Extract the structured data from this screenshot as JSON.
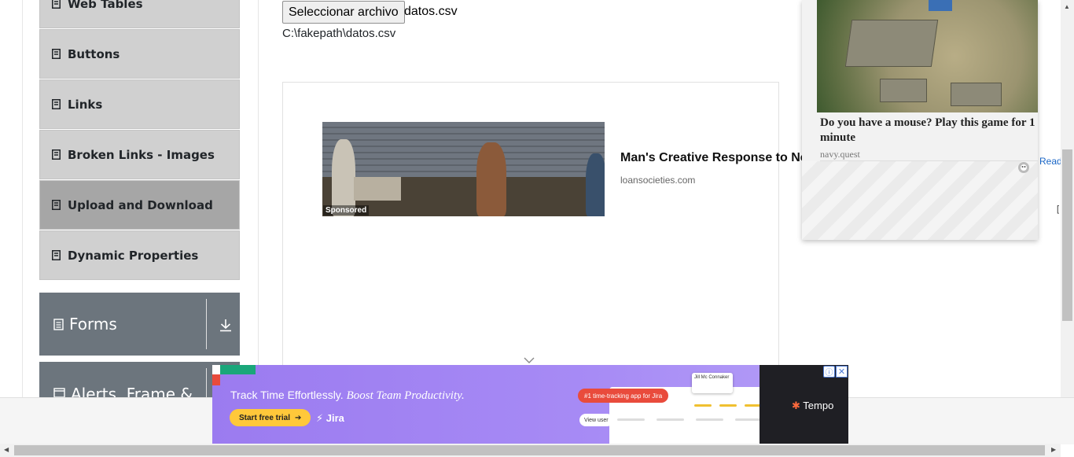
{
  "sidebar": {
    "items": [
      {
        "label": "Web Tables",
        "active": false
      },
      {
        "label": "Buttons",
        "active": false
      },
      {
        "label": "Links",
        "active": false
      },
      {
        "label": "Broken Links - Images",
        "active": false
      },
      {
        "label": "Upload and Download",
        "active": true
      },
      {
        "label": "Dynamic Properties",
        "active": false
      }
    ],
    "groups": [
      {
        "label": "Forms"
      },
      {
        "label": "Alerts, Frame &"
      }
    ]
  },
  "upload": {
    "button_label": "Seleccionar archivo",
    "file_name": "datos.csv",
    "file_path": "C:\\fakepath\\datos.csv"
  },
  "inline_ad": {
    "sponsored_label": "Sponsored",
    "title": "Man's Creative Response to Ne",
    "domain": "loansocieties.com"
  },
  "float_ad": {
    "title": "Do you have a mouse? Play this game for 1 minute",
    "domain": "navy.quest",
    "read_more": "Read m"
  },
  "bottom_banner": {
    "headline": "Track Time Effortlessly.",
    "headline_italic": "Boost Team Productivity.",
    "cta": "Start free trial",
    "partner": "Jira",
    "badge": "#1 time-tracking app for Jira",
    "view_user": "View user",
    "card_title": "Jill Mc Connaker",
    "brand": "Tempo"
  },
  "colors": {
    "sidebar_item_bg": "#d0d0d0",
    "sidebar_item_active_bg": "#a6a6a6",
    "group_bg": "#6c757d",
    "banner_purple": "#a78bf5",
    "cta_yellow": "#ffc83a"
  }
}
